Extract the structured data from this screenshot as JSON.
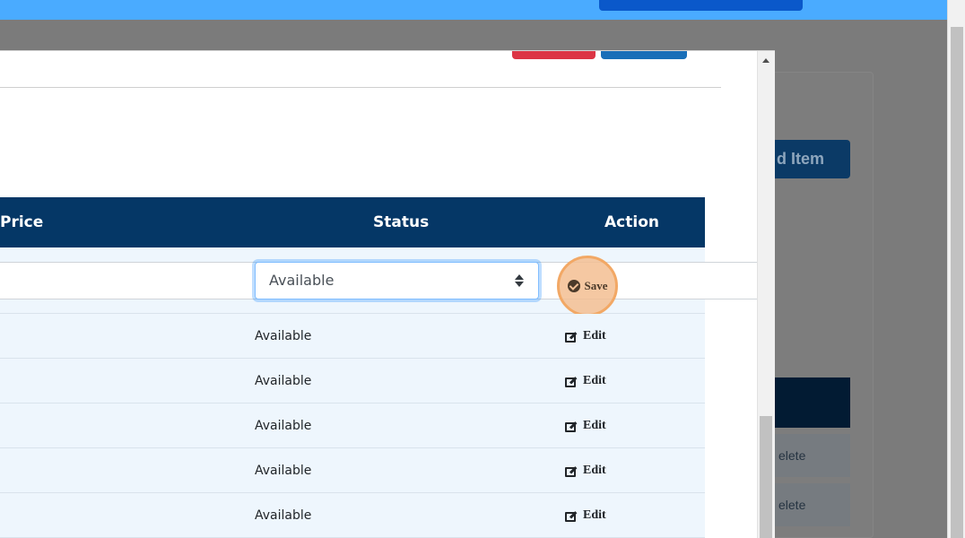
{
  "table": {
    "headers": {
      "price": "Price",
      "status": "Status",
      "action": "Action"
    },
    "edit_row": {
      "price_value": "",
      "status_selected": "Available",
      "save_label": "Save"
    },
    "rows": [
      {
        "status": "Available",
        "action": "Edit"
      },
      {
        "status": "Available",
        "action": "Edit"
      },
      {
        "status": "Available",
        "action": "Edit"
      },
      {
        "status": "Available",
        "action": "Edit"
      },
      {
        "status": "Available",
        "action": "Edit"
      }
    ]
  },
  "background": {
    "add_item_label": "d Item",
    "delete_label": "elete"
  },
  "colors": {
    "header_bg": "#053766",
    "row_bg": "#eef6fd",
    "banner": "#4aabff",
    "save_highlight": "#f2a865"
  }
}
